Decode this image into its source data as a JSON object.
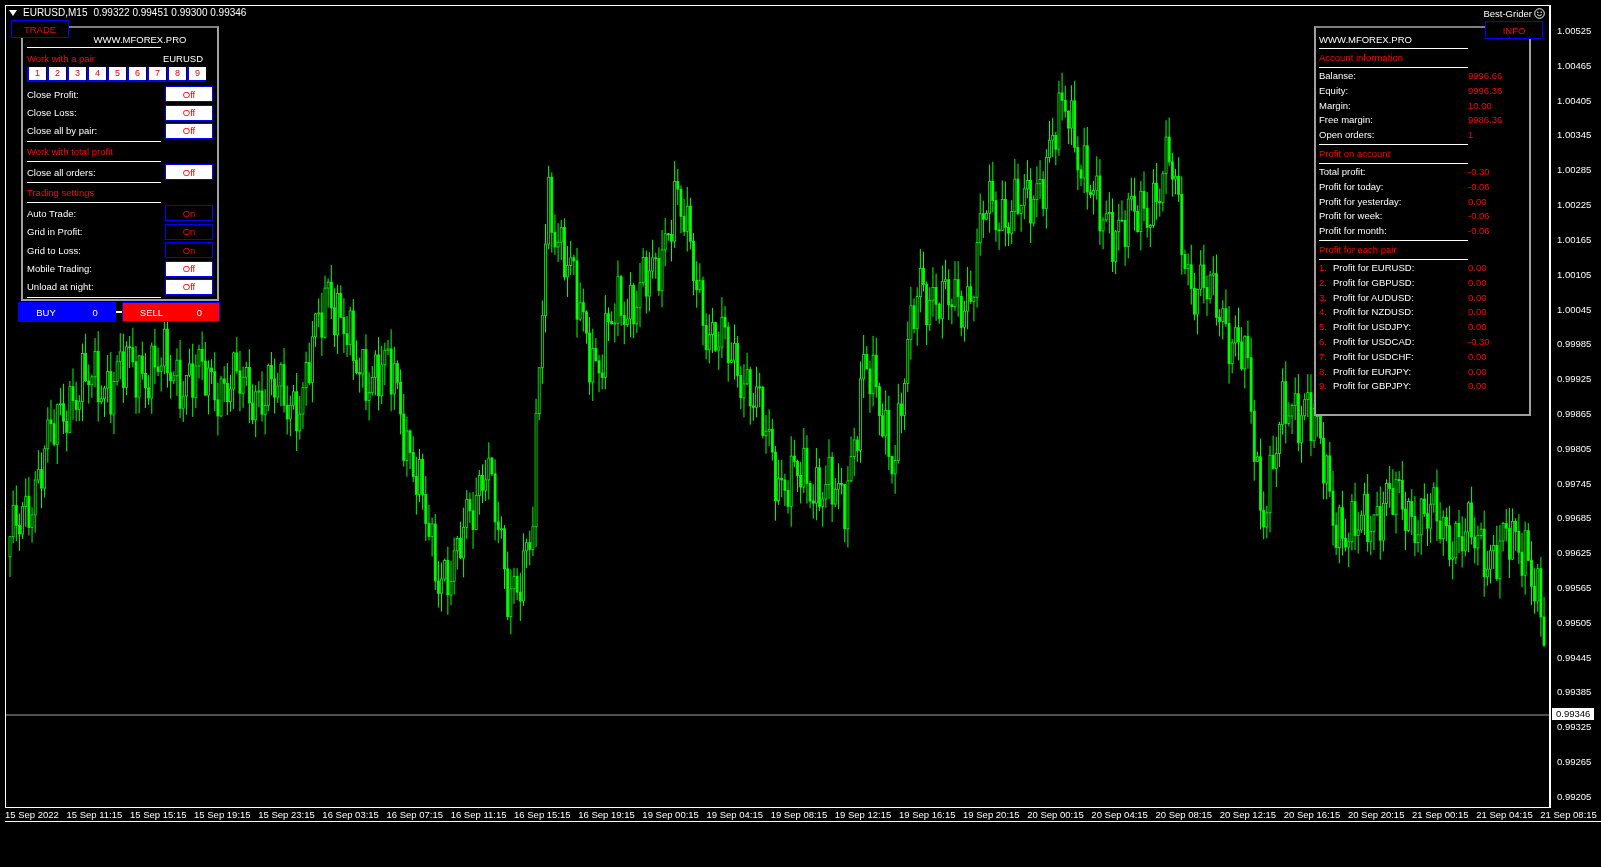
{
  "chart_header": {
    "symbol": "EURUSD,M15",
    "quotes": "0.99322 0.99451 0.99300 0.99346"
  },
  "expert_label": "Best-Grider",
  "trade_panel": {
    "tab": "TRADE",
    "site": "WWW.MFOREX.PRO",
    "pair_heading": "Work with a pair",
    "current_pair": "EURUSD",
    "pair_buttons": [
      "1",
      "2",
      "3",
      "4",
      "5",
      "6",
      "7",
      "8",
      "9"
    ],
    "rows": [
      {
        "kind": "toggle",
        "label": "Close Profit:",
        "value": "Off",
        "on": false
      },
      {
        "kind": "toggle",
        "label": "Close Loss:",
        "value": "Off",
        "on": false
      },
      {
        "kind": "toggle",
        "label": "Close all by pair:",
        "value": "Off",
        "on": false
      },
      {
        "kind": "heading",
        "label": "Work with total profit"
      },
      {
        "kind": "toggle",
        "label": "Close all orders:",
        "value": "Off",
        "on": false
      },
      {
        "kind": "heading",
        "label": "Trading settings"
      },
      {
        "kind": "toggle",
        "label": "Auto Trade:",
        "value": "On",
        "on": true
      },
      {
        "kind": "toggle",
        "label": "Grid in Profit:",
        "value": "On",
        "on": true
      },
      {
        "kind": "toggle",
        "label": "Grid to Loss:",
        "value": "On",
        "on": true
      },
      {
        "kind": "toggle",
        "label": "Mobile Trading:",
        "value": "Off",
        "on": false
      },
      {
        "kind": "toggle",
        "label": "Unload at night:",
        "value": "Off",
        "on": false
      }
    ],
    "buy": {
      "label": "BUY",
      "count": "0"
    },
    "sell": {
      "label": "SELL",
      "count": "0"
    }
  },
  "info_panel": {
    "tab": "INFO",
    "site": "WWW.MFOREX.PRO",
    "sections": [
      {
        "heading": "Account information",
        "rows": [
          {
            "label": "Balanse:",
            "value": "9996.66"
          },
          {
            "label": "Equity:",
            "value": "9996.36"
          },
          {
            "label": "Margin:",
            "value": "10.00"
          },
          {
            "label": "Free margin:",
            "value": "9986.36"
          },
          {
            "label": "Open orders:",
            "value": "1"
          }
        ]
      },
      {
        "heading": "Profit on account",
        "rows": [
          {
            "label": "Total profit:",
            "value": "-0.30"
          },
          {
            "label": "Profit for today:",
            "value": "-0.06"
          },
          {
            "label": "Profit for yesterday:",
            "value": "0.00"
          },
          {
            "label": "Profit for week:",
            "value": "-0.06"
          },
          {
            "label": "Profit for month:",
            "value": "-0.06"
          }
        ]
      },
      {
        "heading": "Profit for each pair",
        "rows": [
          {
            "index": "1.",
            "label": "Profit for EURUSD:",
            "value": "0.00"
          },
          {
            "index": "2.",
            "label": "Profit for GBPUSD:",
            "value": "0.00"
          },
          {
            "index": "3.",
            "label": "Profit for AUDUSD:",
            "value": "0.00"
          },
          {
            "index": "4.",
            "label": "Profit for NZDUSD:",
            "value": "0.00"
          },
          {
            "index": "5.",
            "label": "Profit for USDJPY:",
            "value": "0.00"
          },
          {
            "index": "6.",
            "label": "Profit for USDCAD:",
            "value": "-0.30"
          },
          {
            "index": "7.",
            "label": "Profit for USDCHF:",
            "value": "0.00"
          },
          {
            "index": "8.",
            "label": "Profit for EURJPY:",
            "value": "0.00"
          },
          {
            "index": "9.",
            "label": "Profit for GBPJPY:",
            "value": "0.00"
          }
        ]
      }
    ]
  },
  "price_axis": {
    "labels": [
      "1.00525",
      "1.00465",
      "1.00405",
      "1.00345",
      "1.00285",
      "1.00225",
      "1.00165",
      "1.00105",
      "1.00045",
      "0.99985",
      "0.99925",
      "0.99865",
      "0.99805",
      "0.99745",
      "0.99685",
      "0.99625",
      "0.99565",
      "0.99505",
      "0.99445",
      "0.99385",
      "0.99325",
      "0.99265",
      "0.99205"
    ],
    "current_price": "0.99346"
  },
  "time_axis": {
    "labels": [
      "15 Sep 2022",
      "15 Sep 11:15",
      "15 Sep 15:15",
      "15 Sep 19:15",
      "15 Sep 23:15",
      "16 Sep 03:15",
      "16 Sep 07:15",
      "16 Sep 11:15",
      "16 Sep 15:15",
      "16 Sep 19:15",
      "19 Sep 00:15",
      "19 Sep 04:15",
      "19 Sep 08:15",
      "19 Sep 12:15",
      "19 Sep 16:15",
      "19 Sep 20:15",
      "20 Sep 00:15",
      "20 Sep 04:15",
      "20 Sep 08:15",
      "20 Sep 12:15",
      "20 Sep 16:15",
      "20 Sep 20:15",
      "21 Sep 00:15",
      "21 Sep 04:15",
      "21 Sep 08:15"
    ]
  }
}
